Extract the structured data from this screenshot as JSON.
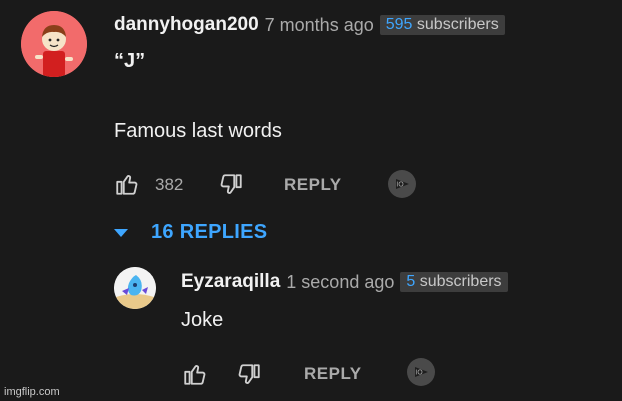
{
  "comment": {
    "author": "dannyhogan200",
    "time": "7 months ago",
    "subscribers_count": "595",
    "subscribers_label": "subscribers",
    "line1": "“J”",
    "line2": "Famous last words",
    "likes": "382",
    "reply_label": "REPLY",
    "avatar_icon": "cartoon-boy-avatar-icon",
    "avatar_bg": "#f26b6b"
  },
  "replies_toggle": {
    "label": "16 REPLIES",
    "icon": "caret-down-icon",
    "color": "#3ea6ff"
  },
  "reply": {
    "author": "Eyzaraqilla",
    "time": "1 second ago",
    "subscribers_count": "5",
    "subscribers_label": "subscribers",
    "text": "Joke",
    "reply_label": "REPLY",
    "avatar_icon": "cartoon-character-avatar-icon"
  },
  "watermark": "imgflip.com",
  "colors": {
    "background": "#1a1a1a",
    "text": "#f1f1f1",
    "secondary": "#aaaaaa",
    "accent": "#3ea6ff"
  }
}
